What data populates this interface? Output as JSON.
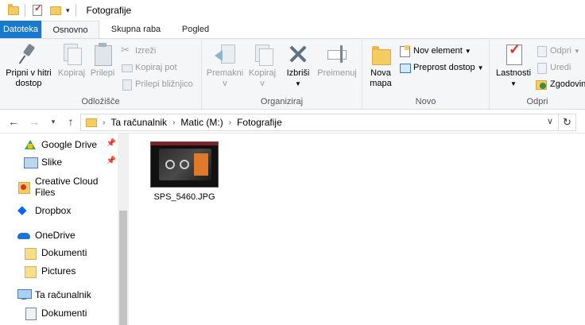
{
  "window": {
    "title": "Fotografije"
  },
  "tabs": {
    "file": "Datoteka",
    "home": "Osnovno",
    "share": "Skupna raba",
    "view": "Pogled"
  },
  "ribbon": {
    "clipboard": {
      "label": "Odložišče",
      "pin_line1": "Pripni v hitri",
      "pin_line2": "dostop",
      "copy": "Kopiraj",
      "paste": "Prilepi",
      "cut": "Izreži",
      "copy_path": "Kopiraj pot",
      "paste_shortcut": "Prilepi bližnjico"
    },
    "organize": {
      "label": "Organiziraj",
      "move_line1": "Premakni",
      "move_line2": "v",
      "copyto_line1": "Kopiraj",
      "copyto_line2": "v",
      "delete": "Izbriši",
      "rename": "Preimenuj"
    },
    "new": {
      "label": "Novo",
      "folder_line1": "Nova",
      "folder_line2": "mapa",
      "new_item": "Nov element",
      "easy_access": "Preprost dostop"
    },
    "open": {
      "label": "Odpri",
      "properties": "Lastnosti",
      "open": "Odpri",
      "edit": "Uredi",
      "history": "Zgodovina"
    }
  },
  "address": {
    "crumbs": [
      "Ta računalnik",
      "Matic (M:)",
      "Fotografije"
    ]
  },
  "nav": {
    "items": [
      {
        "label": "Google Drive",
        "icon": "google-drive-icon",
        "pinned": true
      },
      {
        "label": "Slike",
        "icon": "pictures-icon",
        "pinned": true
      },
      {
        "label": "Creative Cloud Files",
        "icon": "creative-cloud-icon"
      },
      {
        "label": "Dropbox",
        "icon": "dropbox-icon"
      },
      {
        "label": "OneDrive",
        "icon": "onedrive-icon"
      },
      {
        "label": "Dokumenti",
        "icon": "folder-icon"
      },
      {
        "label": "Pictures",
        "icon": "folder-icon"
      },
      {
        "label": "Ta računalnik",
        "icon": "computer-icon"
      },
      {
        "label": "Dokumenti",
        "icon": "documents-icon"
      }
    ]
  },
  "files": [
    {
      "name": "SPS_5460.JPG"
    }
  ],
  "colors": {
    "file_tab": "#1979ca",
    "ribbon_bg": "#f5f6f7",
    "folder": "#f3cd64"
  }
}
